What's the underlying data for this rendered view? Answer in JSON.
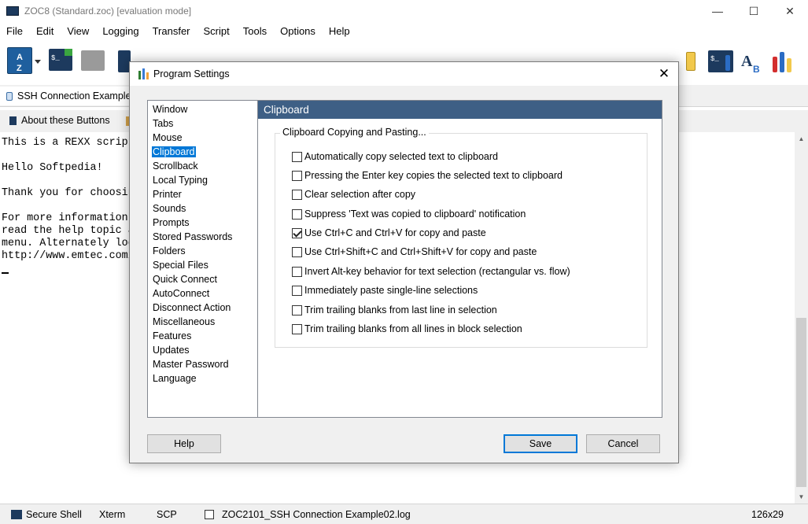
{
  "window": {
    "title": "ZOC8 (Standard.zoc) [evaluation mode]",
    "minimize_glyph": "—",
    "maximize_glyph": "☐",
    "close_glyph": "✕"
  },
  "menu": [
    "File",
    "Edit",
    "View",
    "Logging",
    "Transfer",
    "Script",
    "Tools",
    "Options",
    "Help"
  ],
  "session_tab": {
    "label": "SSH Connection Example"
  },
  "user_buttons": {
    "about_label": "About these Buttons"
  },
  "terminal_lines": [
    "This is a REXX script",
    "",
    "Hello Softpedia!",
    "",
    "Thank you for choosin",
    "",
    "For more information",
    "read the help topic a",
    "menu. Alternately loc",
    "http://www.emtec.com/"
  ],
  "statusbar": {
    "protocol": "Secure Shell",
    "emulation": "Xterm",
    "transfer": "SCP",
    "logfile": "ZOC2101_SSH Connection Example02.log",
    "size": "126x29"
  },
  "dialog": {
    "title": "Program Settings",
    "close_glyph": "✕",
    "nav_items": [
      "Window",
      "Tabs",
      "Mouse",
      "Clipboard",
      "Scrollback",
      "Local Typing",
      "Printer",
      "Sounds",
      "Prompts",
      "Stored Passwords",
      "Folders",
      "Special Files",
      "Quick Connect",
      "AutoConnect",
      "Disconnect Action",
      "Miscellaneous",
      "Features",
      "Updates",
      "Master Password",
      "Language"
    ],
    "selected_nav": "Clipboard",
    "panel_title": "Clipboard",
    "group_title": "Clipboard Copying and Pasting...",
    "options": [
      {
        "label": "Automatically copy selected text to clipboard",
        "checked": false
      },
      {
        "label": "Pressing the Enter key copies the selected text to clipboard",
        "checked": false
      },
      {
        "label": "Clear selection after copy",
        "checked": false
      },
      {
        "label": "Suppress 'Text was copied to clipboard' notification",
        "checked": false
      },
      {
        "label": "Use Ctrl+C and Ctrl+V for copy and paste",
        "checked": true
      },
      {
        "label": "Use Ctrl+Shift+C and Ctrl+Shift+V for copy and paste",
        "checked": false
      },
      {
        "label": "Invert Alt-key behavior for text selection (rectangular vs. flow)",
        "checked": false
      },
      {
        "label": "Immediately paste single-line selections",
        "checked": false
      },
      {
        "label": "Trim trailing blanks from last line in selection",
        "checked": false
      },
      {
        "label": "Trim trailing blanks from all lines in block selection",
        "checked": false
      }
    ],
    "buttons": {
      "help": "Help",
      "save": "Save",
      "cancel": "Cancel"
    }
  },
  "icons": {
    "sort-az-icon": "#1f5f9e",
    "terminal-icon": "#1d3a5e",
    "accent": "#0078d7",
    "panel_header": "#3e5f85"
  }
}
